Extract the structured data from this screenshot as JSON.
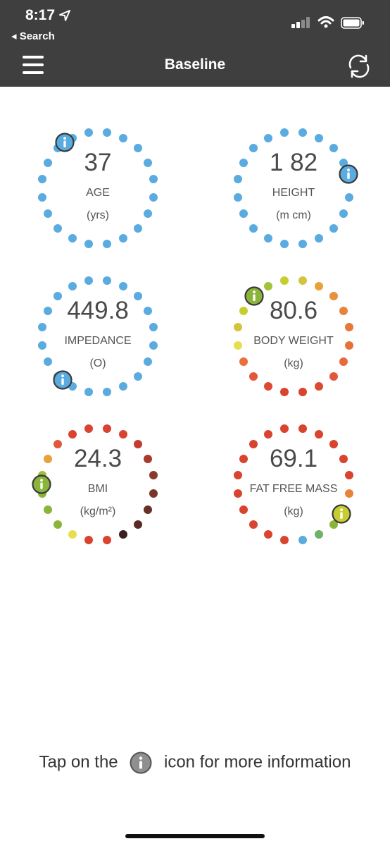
{
  "status_bar": {
    "time": "8:17",
    "back_label": "◂ Search"
  },
  "header": {
    "title": "Baseline",
    "menu_icon": "hamburger-menu-icon",
    "refresh_icon": "refresh-icon"
  },
  "colors": {
    "header_bg": "#3f3f3f",
    "blue": "#5aabe0",
    "info_green": "#8ab43a",
    "info_yellow_green": "#c8cd2f",
    "info_blue": "#5aabe0"
  },
  "metrics": [
    {
      "id": "age",
      "value": "37",
      "label": "AGE",
      "unit": "(yrs)",
      "info_color": "#5aabe0",
      "dot_colors": [
        "#5aabe0",
        "#5aabe0",
        "#5aabe0",
        "#5aabe0",
        "#5aabe0",
        "#5aabe0",
        "#5aabe0",
        "#5aabe0",
        "#5aabe0",
        "#5aabe0",
        "#5aabe0",
        "#5aabe0",
        "#5aabe0",
        "#5aabe0",
        "#5aabe0",
        "#5aabe0",
        "#5aabe0",
        "#5aabe0",
        "#5aabe0",
        "#5aabe0"
      ]
    },
    {
      "id": "height",
      "value": "1 82",
      "label": "HEIGHT",
      "unit": "(m cm)",
      "info_color": "#5aabe0",
      "dot_colors": [
        "#5aabe0",
        "#5aabe0",
        "#5aabe0",
        "#5aabe0",
        "#5aabe0",
        "#5aabe0",
        "#5aabe0",
        "#5aabe0",
        "#5aabe0",
        "#5aabe0",
        "#5aabe0",
        "#5aabe0",
        "#5aabe0",
        "#5aabe0",
        "#5aabe0",
        "#5aabe0",
        "#5aabe0",
        "#5aabe0",
        "#5aabe0",
        "#5aabe0"
      ]
    },
    {
      "id": "impedance",
      "value": "449.8",
      "label": "IMPEDANCE",
      "unit": "(O)",
      "info_color": "#5aabe0",
      "dot_colors": [
        "#5aabe0",
        "#5aabe0",
        "#5aabe0",
        "#5aabe0",
        "#5aabe0",
        "#5aabe0",
        "#5aabe0",
        "#5aabe0",
        "#5aabe0",
        "#5aabe0",
        "#5aabe0",
        "#5aabe0",
        "#5aabe0",
        "#5aabe0",
        "#5aabe0",
        "#5aabe0",
        "#5aabe0",
        "#5aabe0",
        "#5aabe0",
        "#5aabe0"
      ]
    },
    {
      "id": "body-weight",
      "value": "80.6",
      "label": "BODY WEIGHT",
      "unit": "(kg)",
      "info_color": "#8ab43a",
      "dot_colors": [
        "#d4c43c",
        "#e8a23a",
        "#e8903a",
        "#e8843a",
        "#e8783a",
        "#e8703a",
        "#e86a3a",
        "#e2583a",
        "#dd4a34",
        "#d9432f",
        "#d9432f",
        "#dd4a34",
        "#e2583a",
        "#e8703a",
        "#e8de50",
        "#d4c43c",
        "#c8cd2f",
        "#b7c634",
        "#a4c23a",
        "#c8cd2f"
      ]
    },
    {
      "id": "bmi",
      "value": "24.3",
      "label": "BMI",
      "unit": "(kg/m²)",
      "info_color": "#8ab43a",
      "dot_colors": [
        "#d9432f",
        "#d9432f",
        "#c63a30",
        "#a83a2e",
        "#8a3a2c",
        "#7a3529",
        "#6a3027",
        "#5a2a25",
        "#3a2020",
        "#d9432f",
        "#d9432f",
        "#e8de50",
        "#8ab43a",
        "#8ab43a",
        "#8ab43a",
        "#9bbf3a",
        "#e8a23a",
        "#e2583a",
        "#d9432f",
        "#d9432f"
      ]
    },
    {
      "id": "fat-free-mass",
      "value": "69.1",
      "label": "FAT FREE MASS",
      "unit": "(kg)",
      "info_color": "#c8cd2f",
      "dot_colors": [
        "#d9432f",
        "#d9432f",
        "#d9432f",
        "#d9432f",
        "#d9432f",
        "#e8843a",
        "#c8cd2f",
        "#8ab43a",
        "#6fb06a",
        "#5aabe0",
        "#d9432f",
        "#d9432f",
        "#d9432f",
        "#d9432f",
        "#d9432f",
        "#d9432f",
        "#d9432f",
        "#d9432f",
        "#d9432f",
        "#d9432f"
      ]
    }
  ],
  "footer": {
    "text_before": "Tap on the",
    "text_after": "icon for more information",
    "info_icon": "info-icon"
  }
}
